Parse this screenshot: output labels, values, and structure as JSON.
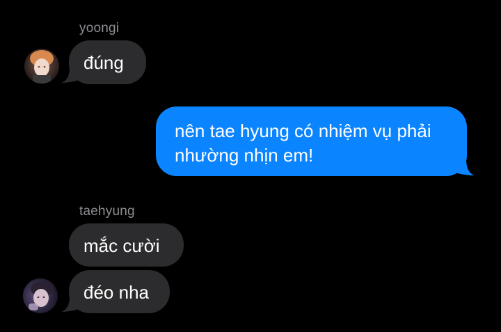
{
  "conversation": {
    "group1": {
      "sender": "yoongi",
      "messages": [
        "đúng"
      ]
    },
    "outgoing": {
      "lines": [
        "nên tae hyung có nhiệm vụ phải",
        "nhường nhịn em!"
      ]
    },
    "group2": {
      "sender": "taehyung",
      "messages": [
        "mắc cười",
        "đéo nha"
      ]
    }
  },
  "colors": {
    "background": "#000000",
    "incoming_bubble": "#2c2c2e",
    "outgoing_bubble": "#0a84ff",
    "sender_name": "#8e8e93",
    "text": "#ffffff"
  },
  "icons": {
    "yoongi_avatar": "avatar-photo",
    "taehyung_avatar": "avatar-photo"
  }
}
